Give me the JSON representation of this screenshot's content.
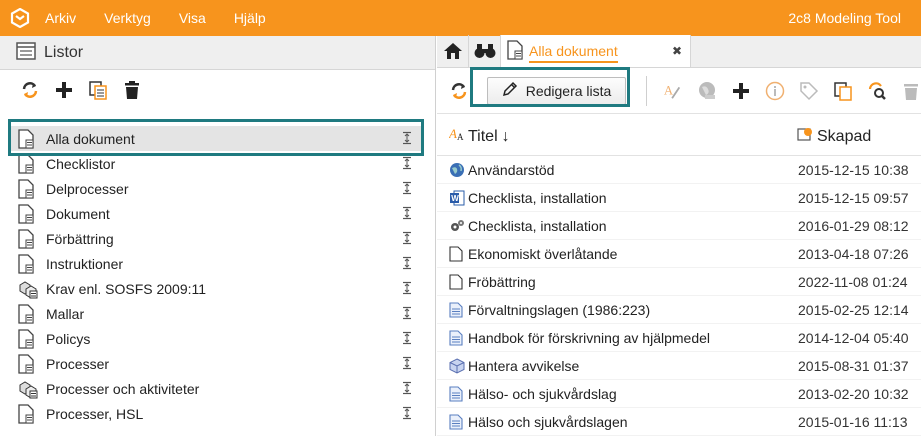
{
  "menubar": {
    "items": [
      "Arkiv",
      "Verktyg",
      "Visa",
      "Hjälp"
    ],
    "app_title": "2c8 Modeling Tool",
    "color": "#f7941d"
  },
  "left": {
    "title": "Listor",
    "lists": [
      {
        "label": "Alla dokument",
        "icon": "document-list-icon",
        "selected": true
      },
      {
        "label": "Checklistor",
        "icon": "document-list-icon"
      },
      {
        "label": "Delprocesser",
        "icon": "document-list-icon"
      },
      {
        "label": "Dokument",
        "icon": "document-list-icon"
      },
      {
        "label": "Förbättring",
        "icon": "document-list-icon"
      },
      {
        "label": "Instruktioner",
        "icon": "document-list-icon"
      },
      {
        "label": "Krav enl. SOSFS 2009:11",
        "icon": "cubes-list-icon"
      },
      {
        "label": "Mallar",
        "icon": "document-list-icon"
      },
      {
        "label": "Policys",
        "icon": "document-list-icon"
      },
      {
        "label": "Processer",
        "icon": "document-list-icon"
      },
      {
        "label": "Processer och aktiviteter",
        "icon": "cubes-list-icon"
      },
      {
        "label": "Processer, HSL",
        "icon": "document-list-icon"
      }
    ]
  },
  "right": {
    "tab_label": "Alla dokument",
    "edit_button_label": "Redigera lista",
    "columns": {
      "title": "Titel",
      "created": "Skapad"
    },
    "documents": [
      {
        "name": "Användarstöd",
        "date": "2015-12-15 10:38",
        "icon": "globe-icon"
      },
      {
        "name": "Checklista, installation",
        "date": "2015-12-15 09:57",
        "icon": "word-doc-icon"
      },
      {
        "name": "Checklista, installation",
        "date": "2016-01-29 08:12",
        "icon": "gears-icon"
      },
      {
        "name": "Ekonomiskt överlåtande",
        "date": "2013-04-18 07:26",
        "icon": "blank-doc-icon"
      },
      {
        "name": "Fröbättring",
        "date": "2022-11-08 01:24",
        "icon": "blank-doc-icon"
      },
      {
        "name": "Förvaltningslagen (1986:223)",
        "date": "2015-02-25 12:14",
        "icon": "text-doc-icon"
      },
      {
        "name": "Handbok för förskrivning av hjälpmedel",
        "date": "2014-12-04 05:40",
        "icon": "text-doc-icon"
      },
      {
        "name": "Hantera avvikelse",
        "date": "2015-08-31 01:37",
        "icon": "cube-icon"
      },
      {
        "name": "Hälso- och sjukvårdslag",
        "date": "2013-02-20 10:32",
        "icon": "text-doc-icon"
      },
      {
        "name": "Hälso och sjukvårdslagen",
        "date": "2015-01-16 11:13",
        "icon": "text-doc-icon"
      }
    ]
  },
  "colors": {
    "accent": "#f7941d",
    "highlight": "#1f7a80"
  }
}
